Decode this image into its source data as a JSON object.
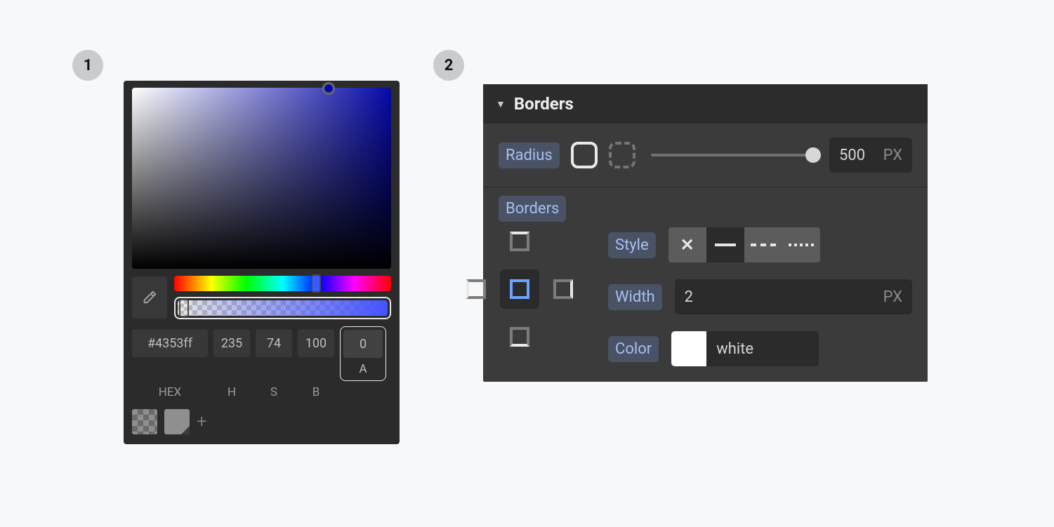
{
  "badges": {
    "one": "1",
    "two": "2"
  },
  "color_picker": {
    "hex": "#4353ff",
    "h": "235",
    "s": "74",
    "b": "100",
    "a": "0",
    "labels": {
      "hex": "HEX",
      "h": "H",
      "s": "S",
      "b": "B",
      "a": "A"
    }
  },
  "borders_panel": {
    "title": "Borders",
    "radius": {
      "label": "Radius",
      "value": "500",
      "unit": "PX"
    },
    "section_label": "Borders",
    "style": {
      "label": "Style",
      "selected": "solid"
    },
    "width": {
      "label": "Width",
      "value": "2",
      "unit": "PX"
    },
    "color": {
      "label": "Color",
      "name": "white",
      "hex": "#ffffff"
    }
  }
}
